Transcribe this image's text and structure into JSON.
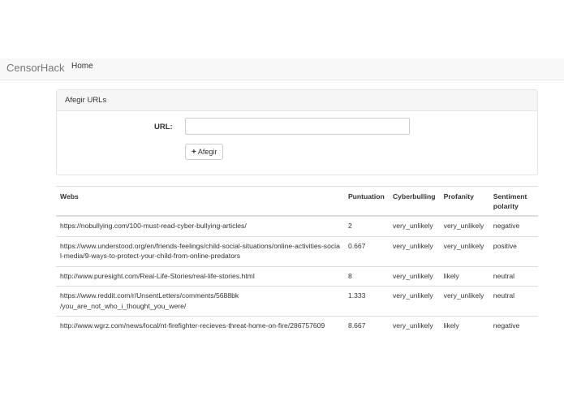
{
  "navbar": {
    "brand": "CensorHack",
    "home": "Home"
  },
  "panel": {
    "heading": "Afegir URLs",
    "url_label": "URL:",
    "url_value": "",
    "add_button": "Afegir"
  },
  "table": {
    "headers": [
      "Webs",
      "Puntuation",
      "Cyberbulling",
      "Profanity",
      "Sentiment polarity"
    ],
    "rows": [
      [
        "https://nobullying.com/100-must-read-cyber-bullying-articles/",
        "2",
        "very_unlikely",
        "very_unlikely",
        "negative"
      ],
      [
        "https://www.understood.org/en/friends-feelings/child-social-situations/online-activities-social-media/9-ways-to-protect-your-child-from-online-predators",
        "0.667",
        "very_unlikely",
        "very_unlikely",
        "positive"
      ],
      [
        "http://www.puresight.com/Real-Life-Stories/real-life-stories.html",
        "8",
        "very_unlikely",
        "likely",
        "neutral"
      ],
      [
        "https://www.reddit.com/r/UnsentLetters/comments/5688bk /you_are_not_who_i_thought_you_were/",
        "1.333",
        "very_unlikely",
        "very_unlikely",
        "neutral"
      ],
      [
        "http://www.wgrz.com/news/local/nt-firefighter-recieves-threat-home-on-fire/286757609",
        "8.667",
        "very_unlikely",
        "likely",
        "negative"
      ]
    ]
  }
}
